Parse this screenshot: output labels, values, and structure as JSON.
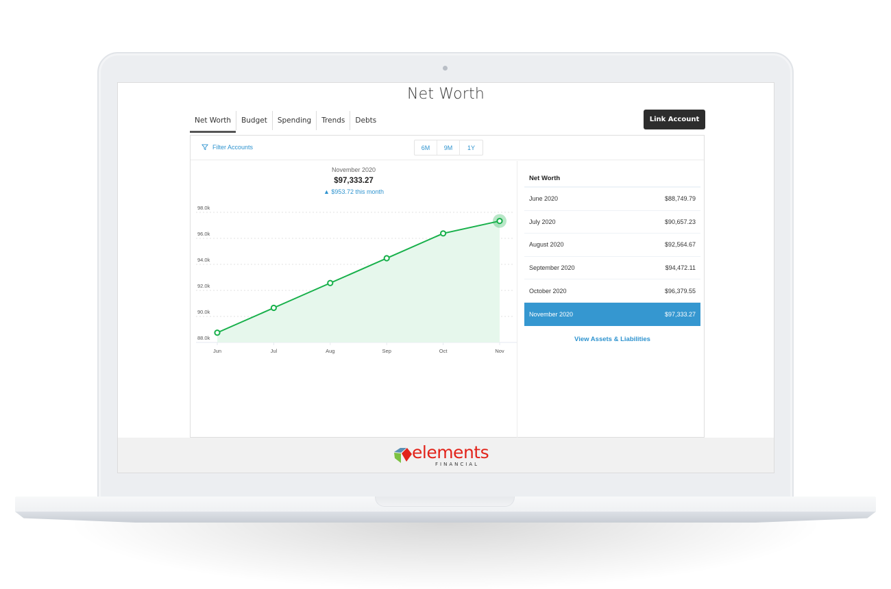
{
  "page": {
    "title": "Net Worth"
  },
  "tabs": [
    {
      "label": "Net Worth",
      "active": true
    },
    {
      "label": "Budget",
      "active": false
    },
    {
      "label": "Spending",
      "active": false
    },
    {
      "label": "Trends",
      "active": false
    },
    {
      "label": "Debts",
      "active": false
    }
  ],
  "toolbar": {
    "link_account_label": "Link Account",
    "filter_label": "Filter Accounts",
    "filter_icon": "funnel-icon",
    "ranges": [
      "6M",
      "9M",
      "1Y"
    ]
  },
  "summary": {
    "month": "November 2020",
    "value": "$97,333.27",
    "change_icon": "triangle-up-icon",
    "change": "▲ $953.72 this month"
  },
  "net_worth_table": {
    "header": "Net Worth",
    "rows": [
      {
        "month": "June 2020",
        "value": "$88,749.79",
        "selected": false
      },
      {
        "month": "July 2020",
        "value": "$90,657.23",
        "selected": false
      },
      {
        "month": "August 2020",
        "value": "$92,564.67",
        "selected": false
      },
      {
        "month": "September 2020",
        "value": "$94,472.11",
        "selected": false
      },
      {
        "month": "October 2020",
        "value": "$96,379.55",
        "selected": false
      },
      {
        "month": "November 2020",
        "value": "$97,333.27",
        "selected": true
      }
    ],
    "link_label": "View Assets & Liabilities"
  },
  "footer": {
    "brand_word": "elements",
    "brand_sub": "FINANCIAL"
  },
  "colors": {
    "accent_blue": "#3597d0",
    "link_blue": "#2e93cf",
    "line_green": "#17b04a",
    "area_green": "#e6f7ec",
    "button_dark": "#2d2d2d",
    "brand_red": "#e2231a"
  },
  "chart_data": {
    "type": "area",
    "title": "",
    "xlabel": "",
    "ylabel": "",
    "categories": [
      "Jun",
      "Jul",
      "Aug",
      "Sep",
      "Oct",
      "Nov"
    ],
    "series": [
      {
        "name": "Net Worth",
        "values": [
          88749.79,
          90657.23,
          92564.67,
          94472.11,
          96379.55,
          97333.27
        ]
      }
    ],
    "ylim": [
      88000,
      98000
    ],
    "yticks": [
      98000,
      96000,
      94000,
      92000,
      90000,
      88000
    ],
    "ytick_labels": [
      "98.0k",
      "96.0k",
      "94.0k",
      "92.0k",
      "90.0k",
      "88.0k"
    ],
    "grid": true,
    "highlighted_point": "Nov"
  }
}
